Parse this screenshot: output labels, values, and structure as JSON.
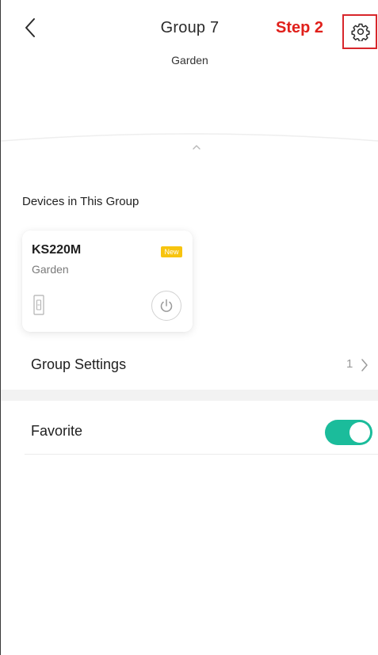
{
  "header": {
    "title": "Group 7",
    "subtitle": "Garden",
    "annotation": "Step 2",
    "back_icon": "chevron-left-icon",
    "settings_icon": "gear-icon"
  },
  "group_section": {
    "title": "Devices in This Group",
    "devices": [
      {
        "name": "KS220M",
        "room": "Garden",
        "badge": "New",
        "type_icon": "light-switch-icon",
        "power_icon": "power-icon"
      }
    ]
  },
  "settings_row": {
    "label": "Group Settings",
    "count": "1"
  },
  "favorite_row": {
    "label": "Favorite",
    "enabled": true
  },
  "colors": {
    "annotation": "#e0201b",
    "toggle_on": "#1bbc9b",
    "badge": "#f7c40f"
  }
}
